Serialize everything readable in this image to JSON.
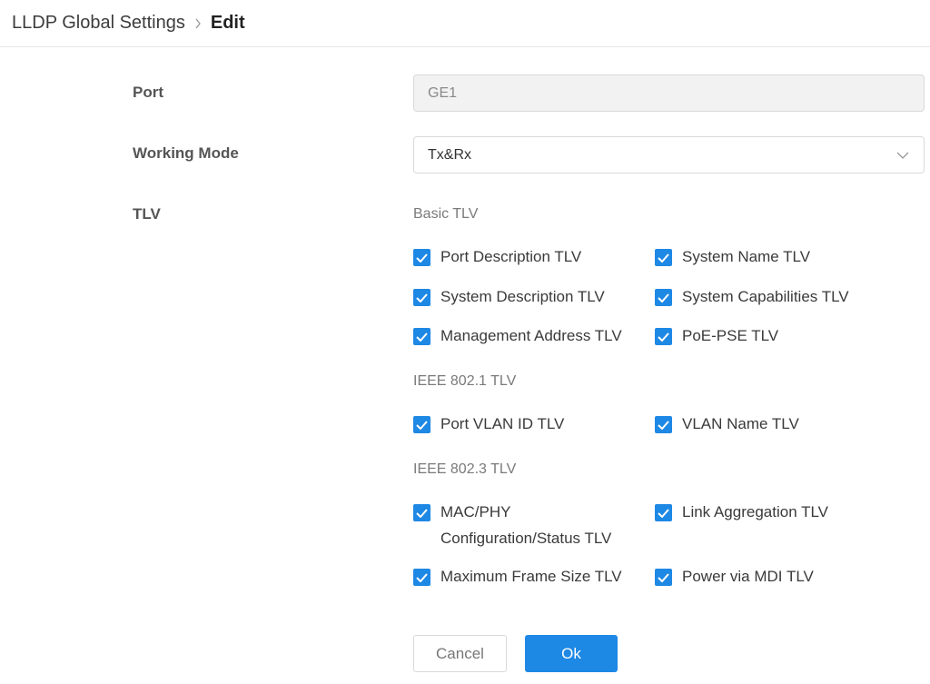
{
  "breadcrumb": {
    "parent": "LLDP Global Settings",
    "current": "Edit"
  },
  "form": {
    "port": {
      "label": "Port",
      "value": "GE1"
    },
    "working_mode": {
      "label": "Working Mode",
      "value": "Tx&Rx"
    },
    "tlv": {
      "label": "TLV"
    }
  },
  "groups": {
    "basic": {
      "title": "Basic TLV",
      "items": [
        {
          "label": "Port Description TLV",
          "checked": true
        },
        {
          "label": "System Name TLV",
          "checked": true
        },
        {
          "label": "System Description TLV",
          "checked": true
        },
        {
          "label": "System Capabilities TLV",
          "checked": true
        },
        {
          "label": "Management Address TLV",
          "checked": true
        },
        {
          "label": "PoE-PSE TLV",
          "checked": true
        }
      ]
    },
    "ieee8021": {
      "title": "IEEE 802.1 TLV",
      "items": [
        {
          "label": "Port VLAN ID TLV",
          "checked": true
        },
        {
          "label": "VLAN Name TLV",
          "checked": true
        }
      ]
    },
    "ieee8023": {
      "title": "IEEE 802.3 TLV",
      "items": [
        {
          "label": "MAC/PHY Configuration/Status TLV",
          "checked": true
        },
        {
          "label": "Link Aggregation TLV",
          "checked": true
        },
        {
          "label": "Maximum Frame Size TLV",
          "checked": true
        },
        {
          "label": "Power via MDI TLV",
          "checked": true
        }
      ]
    }
  },
  "buttons": {
    "cancel": "Cancel",
    "ok": "Ok"
  },
  "colors": {
    "accent": "#1e88e5"
  }
}
